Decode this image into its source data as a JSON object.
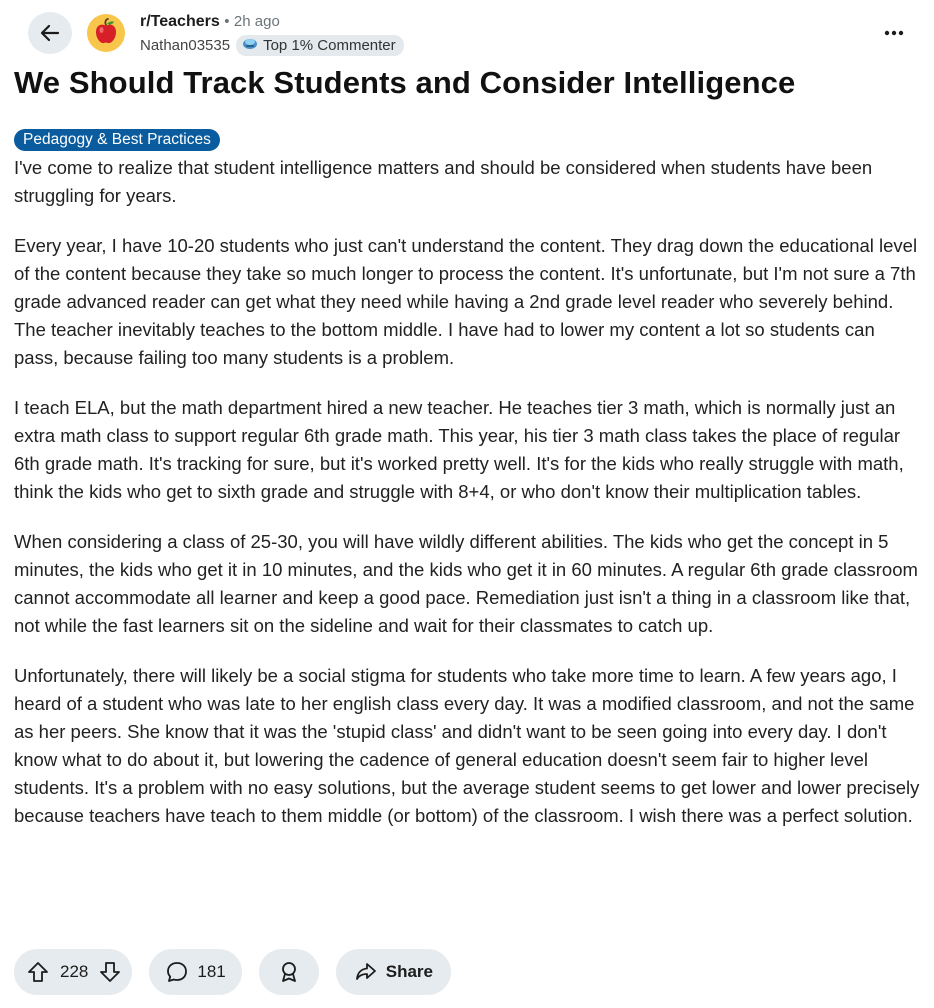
{
  "header": {
    "subreddit": "r/Teachers",
    "separator": "•",
    "time": "2h ago",
    "author": "Nathan03535",
    "author_badge": "Top 1% Commenter"
  },
  "post": {
    "title": "We Should Track Students and Consider Intelligence",
    "flair": "Pedagogy & Best Practices",
    "paragraphs": [
      "I've come to realize that student intelligence matters and should be considered when students have been struggling for years.",
      "Every year, I have 10-20 students who just can't understand the content. They drag down the educational level of the content because they take so much longer to process the content. It's unfortunate, but I'm not sure a 7th grade advanced reader can get what they need while having a 2nd grade level reader who severely behind. The teacher inevitably teaches to the bottom middle. I have had to lower my content a lot so students can pass, because failing too many students is a problem.",
      "I teach ELA, but the math department hired a new teacher. He teaches tier 3 math, which is normally just an extra math class to support regular 6th grade math. This year, his tier 3 math class takes the place of regular 6th grade math. It's tracking for sure, but it's worked pretty well. It's for the kids who really struggle with math, think the kids who get to sixth grade and struggle with 8+4, or who don't know their multiplication tables.",
      "When considering a class of 25-30, you will have wildly different abilities. The kids who get the concept in 5 minutes, the kids who get it in 10 minutes, and the kids who get it in 60 minutes. A regular 6th grade classroom cannot accommodate all learner and keep a good pace. Remediation just isn't a thing in a classroom like that, not while the fast learners sit on the sideline and wait for their classmates to catch up.",
      "Unfortunately, there will likely be a social stigma for students who take more time to learn. A few years ago, I heard of a student who was late to her english class every day. It was a modified classroom, and not the same as her peers. She know that it was the 'stupid class' and didn't want to be seen going into every day. I don't know what to do about it, but lowering the cadence of general education doesn't seem fair to higher level students. It's a problem with no easy solutions, but the average student seems to get lower and lower precisely because teachers have teach to them middle (or bottom) of the classroom. I wish there was a perfect solution."
    ]
  },
  "actions": {
    "votes": "228",
    "comments": "181",
    "share_label": "Share"
  },
  "icons": {
    "back": "back-arrow-icon",
    "avatar": "apple-icon",
    "badge": "commenter-badge-icon",
    "more": "more-options-icon",
    "upvote": "upvote-icon",
    "downvote": "downvote-icon",
    "comment": "comment-icon",
    "award": "award-icon",
    "share": "share-icon"
  },
  "colors": {
    "background": "#ffffff",
    "pill_background": "#e5ebee",
    "flair_background": "#0a5c9f",
    "avatar_background": "#f7c64a"
  }
}
